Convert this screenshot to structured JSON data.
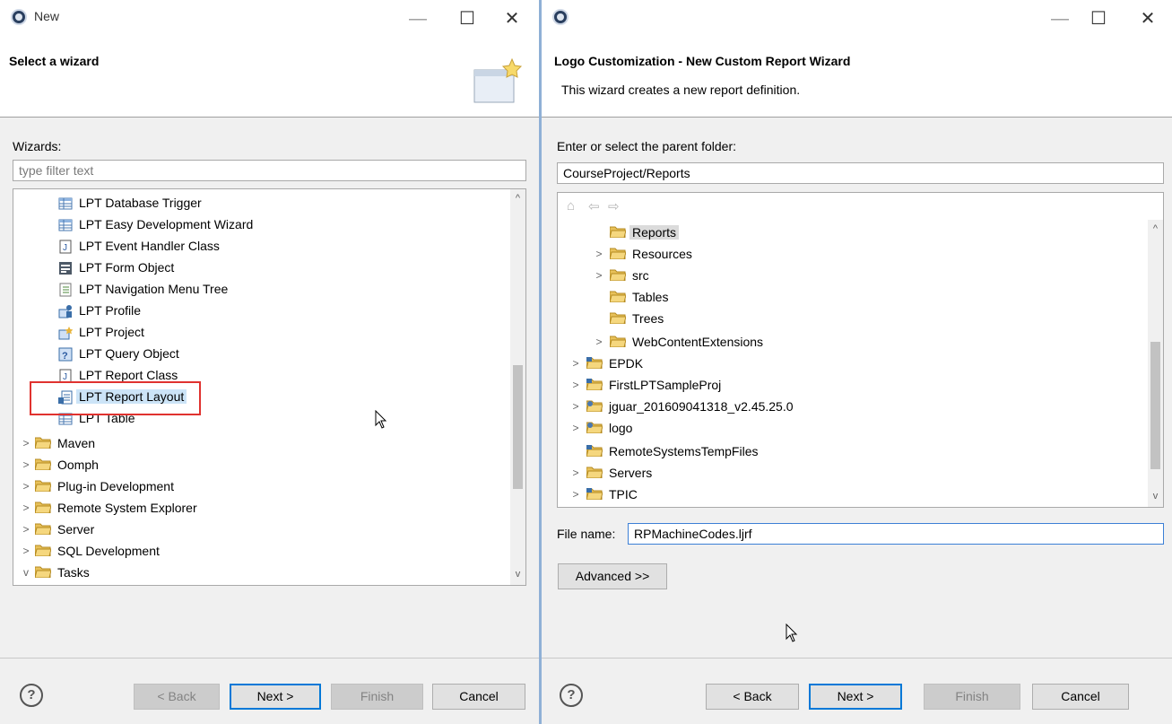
{
  "left": {
    "window_title": "New",
    "header_title": "Select a wizard",
    "wizards_label": "Wizards:",
    "filter_placeholder": "type filter text",
    "items": [
      {
        "label": "LPT Database Trigger"
      },
      {
        "label": "LPT Easy Development Wizard"
      },
      {
        "label": "LPT Event Handler Class"
      },
      {
        "label": "LPT Form Object"
      },
      {
        "label": "LPT Navigation Menu Tree"
      },
      {
        "label": "LPT Profile"
      },
      {
        "label": "LPT Project"
      },
      {
        "label": "LPT Query Object"
      },
      {
        "label": "LPT Report Class"
      },
      {
        "label": "LPT Report Layout"
      },
      {
        "label": "LPT Table"
      },
      {
        "label": "Maven"
      },
      {
        "label": "Oomph"
      },
      {
        "label": "Plug-in Development"
      },
      {
        "label": "Remote System Explorer"
      },
      {
        "label": "Server"
      },
      {
        "label": "SQL Development"
      },
      {
        "label": "Tasks"
      }
    ],
    "buttons": {
      "help": "?",
      "back": "< Back",
      "next": "Next >",
      "finish": "Finish",
      "cancel": "Cancel"
    }
  },
  "right": {
    "header_title": "Logo Customization - New Custom Report Wizard",
    "header_desc": "This wizard creates a new report definition.",
    "parent_label": "Enter or select the parent folder:",
    "parent_value": "CourseProject/Reports",
    "tree_items": [
      {
        "label": "Reports"
      },
      {
        "label": "Resources"
      },
      {
        "label": "src"
      },
      {
        "label": "Tables"
      },
      {
        "label": "Trees"
      },
      {
        "label": "WebContentExtensions"
      },
      {
        "label": "EPDK"
      },
      {
        "label": "FirstLPTSampleProj"
      },
      {
        "label": "jguar_201609041318_v2.45.25.0"
      },
      {
        "label": "logo"
      },
      {
        "label": "RemoteSystemsTempFiles"
      },
      {
        "label": "Servers"
      },
      {
        "label": "TPIC"
      }
    ],
    "file_name_label": "File name:",
    "file_name_value": "RPMachineCodes.ljrf",
    "advanced_button": "Advanced >>",
    "buttons": {
      "help": "?",
      "back": "< Back",
      "next": "Next >",
      "finish": "Finish",
      "cancel": "Cancel"
    }
  },
  "window_controls": {
    "minimize": "—",
    "maximize": "☐",
    "close": "✕"
  },
  "colors": {
    "selection": "#cce4f7",
    "highlight_box": "#e0322f",
    "primary_button_border": "#0078d7",
    "folder": "#e8c15a"
  }
}
